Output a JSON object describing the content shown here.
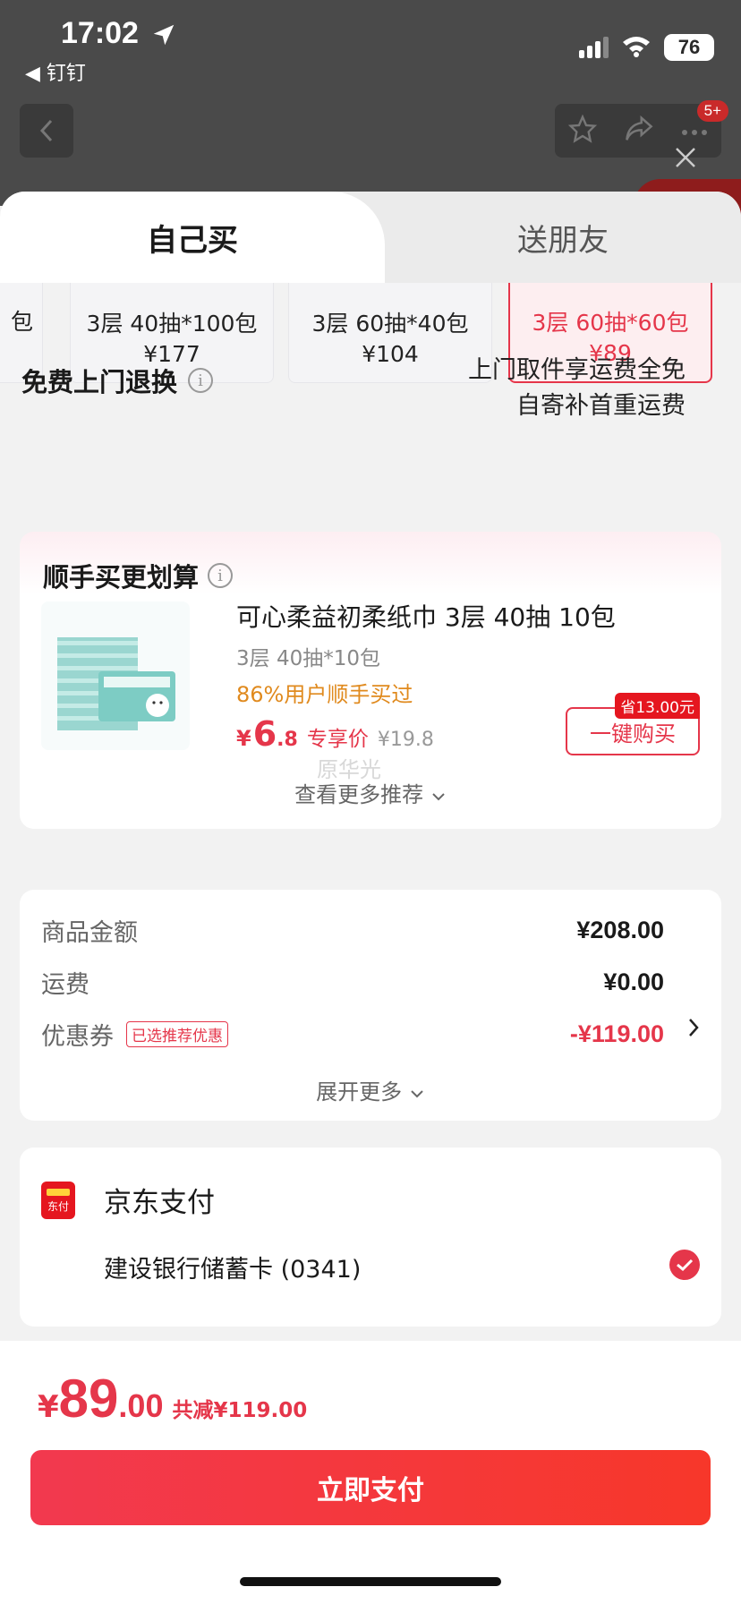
{
  "status": {
    "time": "17:02",
    "back_app": "◀ 钉钉",
    "battery": "76"
  },
  "nav": {
    "badge": "5+"
  },
  "tabs": {
    "self": "自己买",
    "gift": "送朋友"
  },
  "specs": [
    {
      "label": "包",
      "price": ""
    },
    {
      "label": "3层 40抽*100包",
      "price": "¥177"
    },
    {
      "label": "3层 60抽*40包",
      "price": "¥104"
    },
    {
      "label": "3层 60抽*60包",
      "price": "¥89"
    }
  ],
  "returns": {
    "title": "免费上门退换",
    "line1": "上门取件享运费全免",
    "line2": "自寄补首重运费"
  },
  "reco": {
    "title": "顺手买更划算",
    "name": "可心柔益初柔纸巾 3层 40抽 10包",
    "spec": "3层 40抽*10包",
    "pct": "86%用户顺手买过",
    "yen": "¥",
    "int": "6",
    "dec": ".8",
    "tag": "专享价",
    "orig": "¥19.8",
    "save": "省13.00元",
    "buy": "一键购买",
    "more": "查看更多推荐"
  },
  "summary": {
    "goods_label": "商品金额",
    "goods_val": "¥208.00",
    "ship_label": "运费",
    "ship_val": "¥0.00",
    "coupon_label": "优惠券",
    "coupon_tag": "已选推荐优惠",
    "coupon_val": "-¥119.00",
    "expand": "展开更多"
  },
  "payment": {
    "icon_text": "东付",
    "name": "京东支付",
    "bank": "建设银行储蓄卡 (0341)"
  },
  "bottom": {
    "yen": "¥",
    "int": "89",
    "dec": ".00",
    "save": "共减¥119.00",
    "pay_btn": "立即支付"
  },
  "watermark": "原华光",
  "colors": {
    "accent": "#e5364a",
    "orange": "#e08a1e"
  }
}
